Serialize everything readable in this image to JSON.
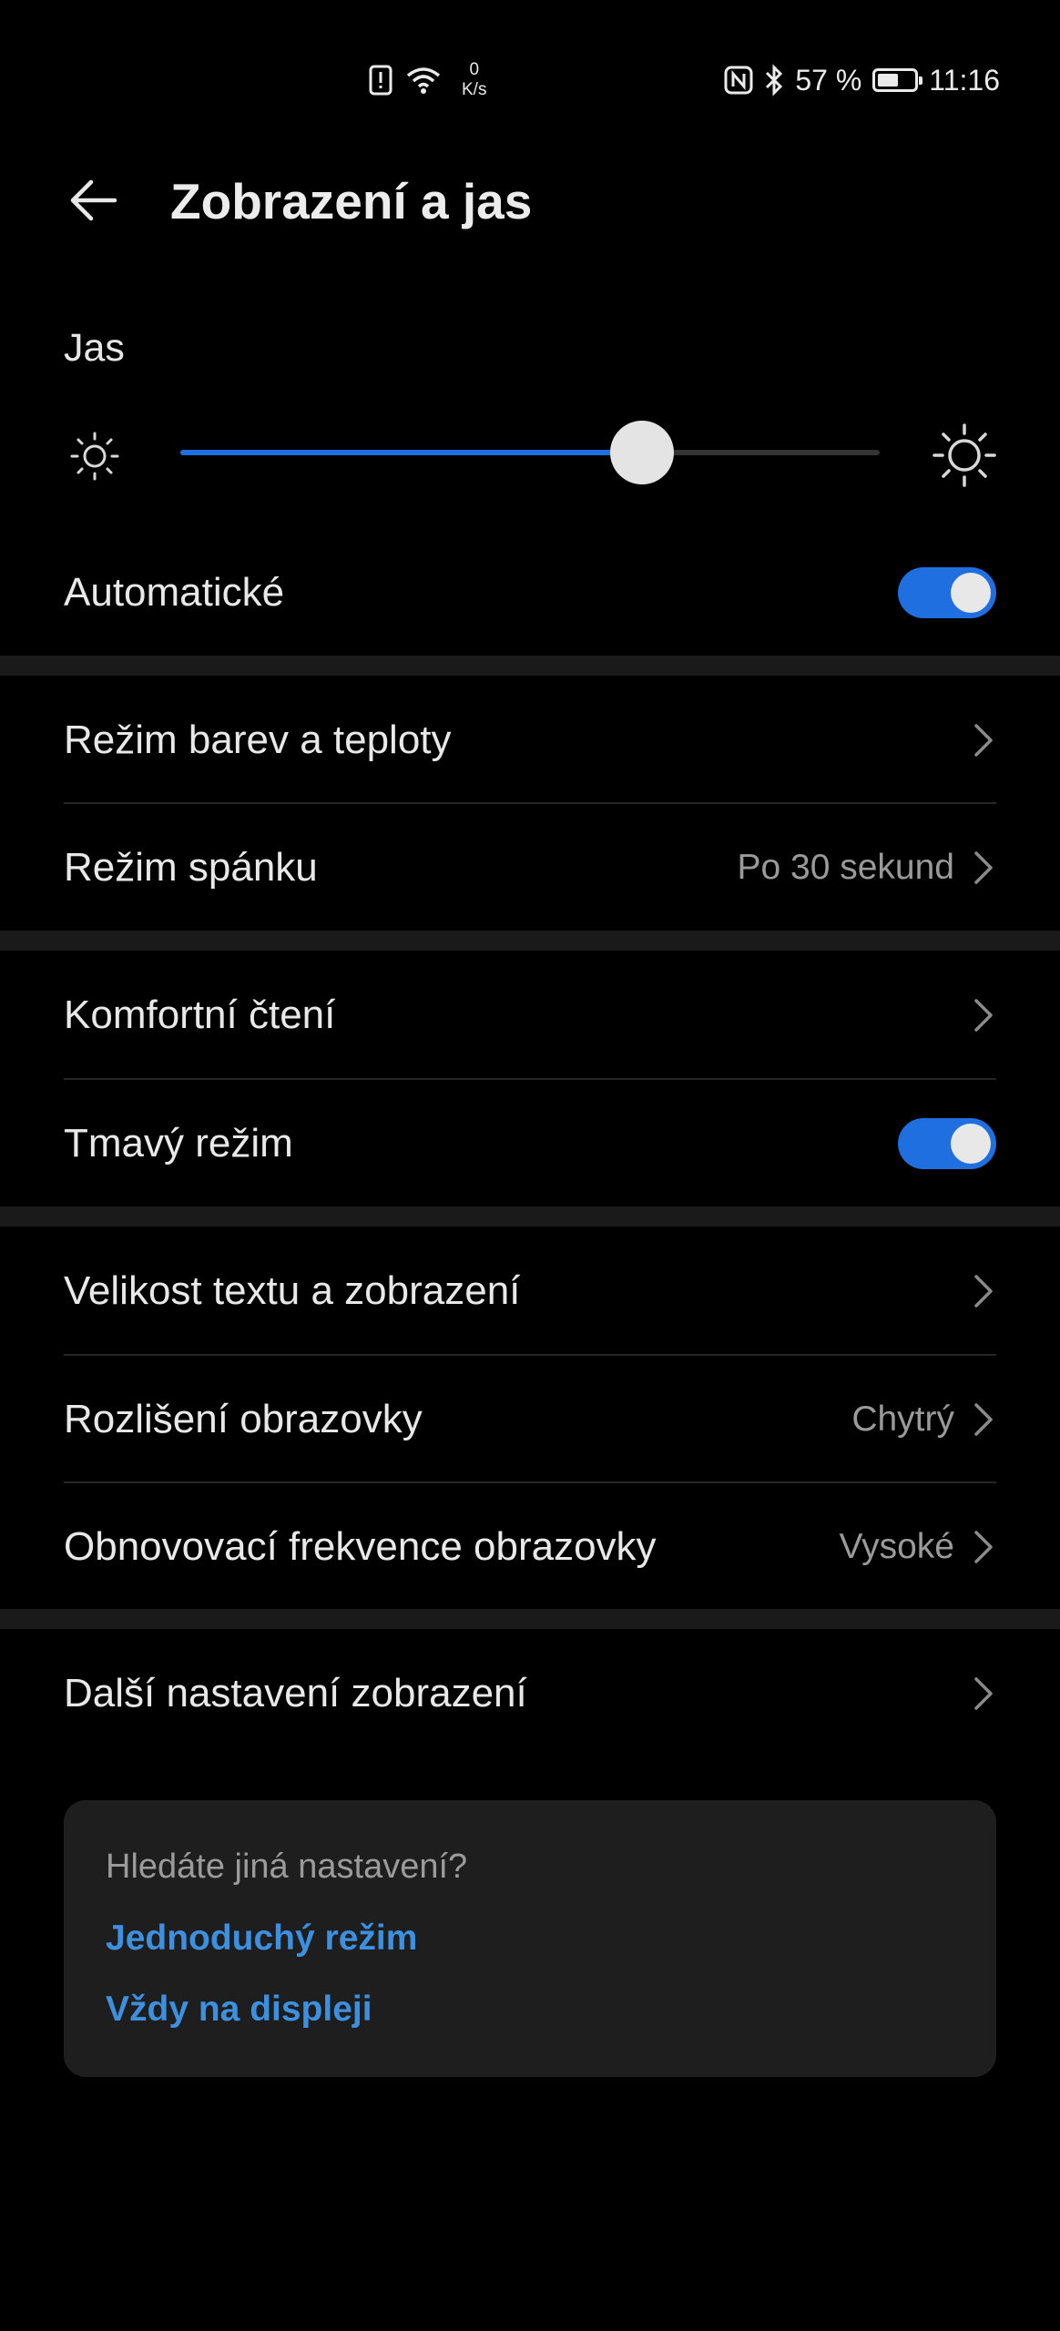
{
  "status_bar": {
    "net_speed_value": "0",
    "net_speed_unit": "K/s",
    "battery_percent": "57 %",
    "battery_level": 0.57,
    "time": "11:16",
    "icons": [
      "alert-icon",
      "wifi-icon",
      "nfc-icon",
      "bluetooth-icon",
      "battery-icon"
    ]
  },
  "header": {
    "title": "Zobrazení a jas"
  },
  "brightness": {
    "label": "Jas",
    "level": 0.66
  },
  "settings": {
    "automatic": {
      "label": "Automatické",
      "on": true
    },
    "color_mode": {
      "label": "Režim barev a teploty"
    },
    "sleep": {
      "label": "Režim spánku",
      "value": "Po 30 sekund"
    },
    "comfort_reading": {
      "label": "Komfortní čtení"
    },
    "dark_mode": {
      "label": "Tmavý režim",
      "on": true
    },
    "text_size": {
      "label": "Velikost textu a zobrazení"
    },
    "resolution": {
      "label": "Rozlišení obrazovky",
      "value": "Chytrý"
    },
    "refresh_rate": {
      "label": "Obnovovací frekvence obrazovky",
      "value": "Vysoké"
    },
    "more_display": {
      "label": "Další nastavení zobrazení"
    }
  },
  "suggestions": {
    "question": "Hledáte jiná nastavení?",
    "links": [
      "Jednoduchý režim",
      "Vždy na displeji"
    ]
  },
  "colors": {
    "accent": "#1f6fe0",
    "link": "#3d8fe0",
    "background": "#000000"
  }
}
